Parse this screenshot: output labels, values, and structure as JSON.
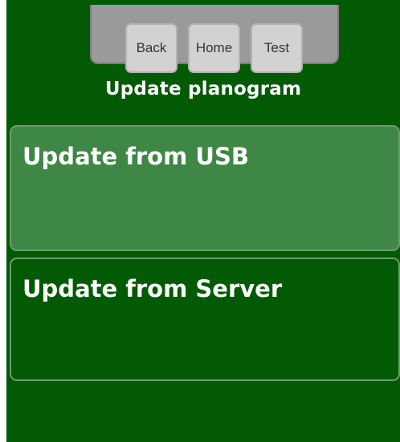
{
  "nav": {
    "back_label": "Back",
    "home_label": "Home",
    "test_label": "Test"
  },
  "page": {
    "title": "Update planogram"
  },
  "options": [
    {
      "label": "Update from USB",
      "highlighted": true
    },
    {
      "label": "Update from Server",
      "highlighted": false
    }
  ],
  "colors": {
    "background": "#035a04",
    "highlighted_option": "#3e8744",
    "nav_tray": "#9a9a9a",
    "nav_button": "#d2d2d2",
    "text": "#ffffff"
  }
}
